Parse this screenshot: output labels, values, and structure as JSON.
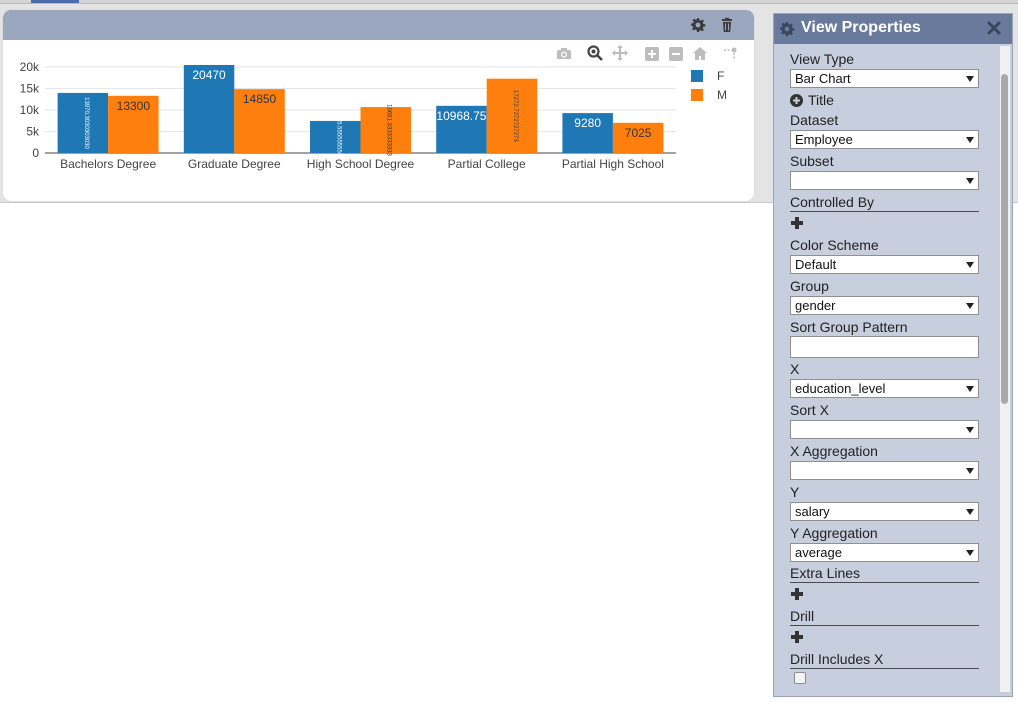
{
  "chart_card": {
    "header_icons": [
      "gear-icon",
      "trash-icon"
    ],
    "modebar_icons": [
      "camera-icon",
      "zoom-icon",
      "pan-icon",
      "zoom-in-icon",
      "zoom-out-icon",
      "home-icon",
      "spike-lines-icon"
    ]
  },
  "chart_data": {
    "type": "bar",
    "categories": [
      "Bachelors Degree",
      "Graduate Degree",
      "High School Degree",
      "Partial College",
      "Partial High School"
    ],
    "series": [
      {
        "name": "F",
        "color": "#1f77b4",
        "values": [
          13970.3,
          20470,
          7455.5556,
          10968.75,
          9280
        ],
        "labels": [
          "13970.3030303030",
          "20470",
          "7455.55555555556",
          "10968.75",
          "9280"
        ]
      },
      {
        "name": "M",
        "color": "#ff7f0e",
        "values": [
          13300,
          14850,
          10681.3333,
          17272.7273,
          7025
        ],
        "labels": [
          "13300",
          "14850",
          "10681.3333333333",
          "17272.7272727273",
          "7025"
        ]
      }
    ],
    "yticks": [
      "0",
      "5k",
      "10k",
      "15k",
      "20k"
    ],
    "ylim": [
      0,
      21000
    ],
    "grid": true,
    "legend_position": "right"
  },
  "panel": {
    "title": "View Properties",
    "view_type_label": "View Type",
    "view_type_value": "Bar Chart",
    "title_label": "Title",
    "dataset_label": "Dataset",
    "dataset_value": "Employee",
    "subset_label": "Subset",
    "subset_value": "",
    "controlled_by_label": "Controlled By",
    "color_scheme_label": "Color Scheme",
    "color_scheme_value": "Default",
    "group_label": "Group",
    "group_value": "gender",
    "sort_group_label": "Sort Group Pattern",
    "sort_group_value": "",
    "x_label": "X",
    "x_value": "education_level",
    "sort_x_label": "Sort X",
    "sort_x_value": "",
    "x_agg_label": "X Aggregation",
    "x_agg_value": "",
    "y_label": "Y",
    "y_value": "salary",
    "y_agg_label": "Y Aggregation",
    "y_agg_value": "average",
    "extra_lines_label": "Extra Lines",
    "drill_label": "Drill",
    "drill_x_label": "Drill Includes X",
    "drill_x_checked": false
  }
}
